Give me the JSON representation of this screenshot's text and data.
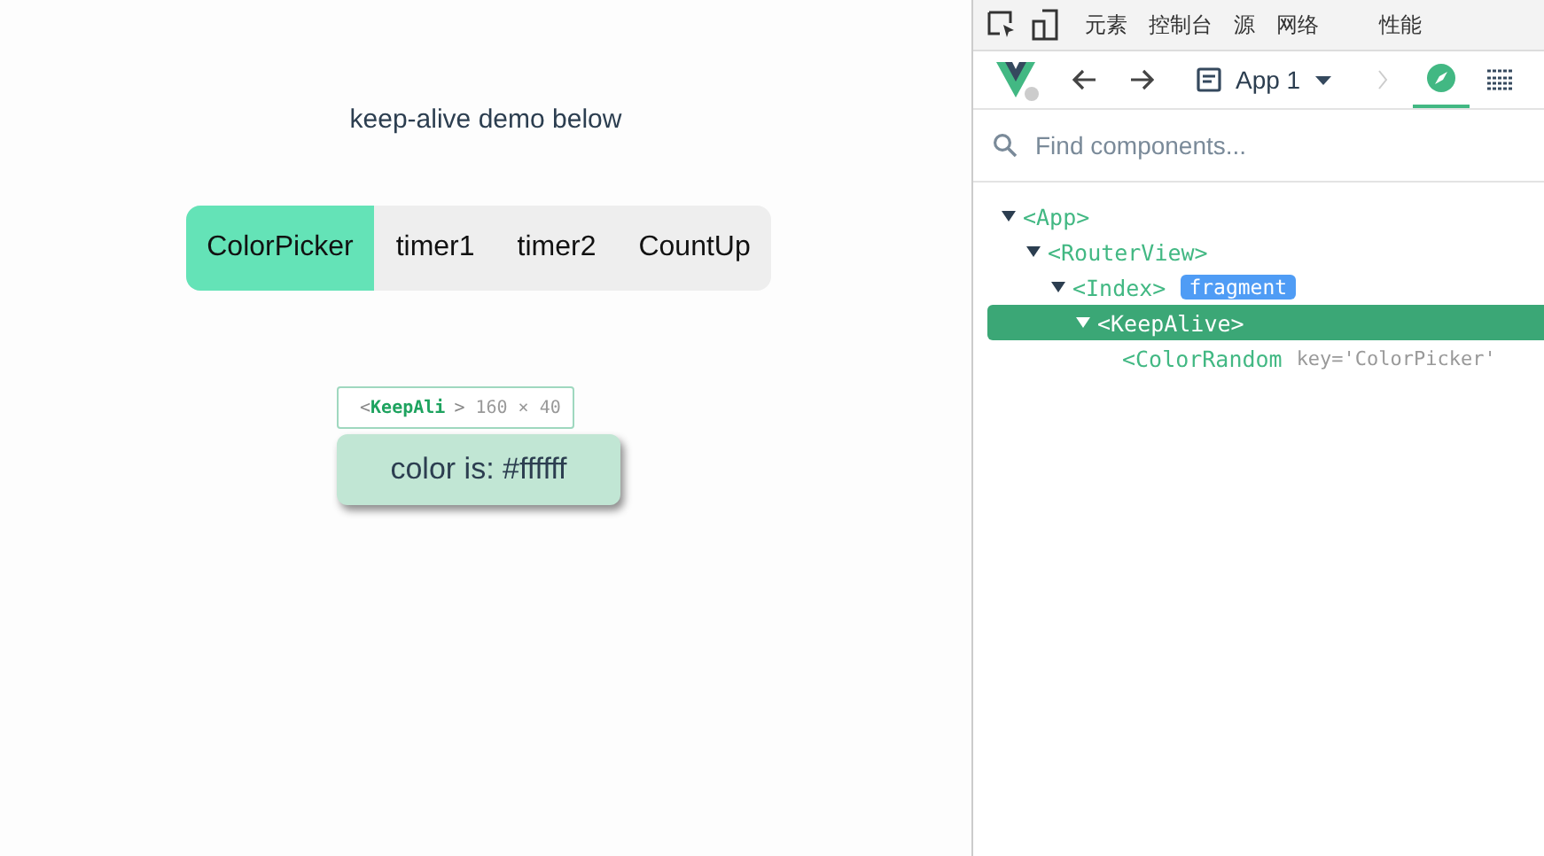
{
  "app": {
    "heading": "keep-alive demo below",
    "tabs": [
      {
        "label": "ColorPicker",
        "selected": true
      },
      {
        "label": "timer1",
        "selected": false
      },
      {
        "label": "timer2",
        "selected": false
      },
      {
        "label": "CountUp",
        "selected": false
      }
    ],
    "inspector_tooltip": {
      "open": "<",
      "name": "KeepAli",
      "close": ">",
      "size": "160 × 40"
    },
    "color_box": {
      "text": "color is: #ffffff"
    }
  },
  "devtools": {
    "panel_tabs": [
      {
        "label": "元素",
        "selected": false
      },
      {
        "label": "控制台",
        "selected": false
      },
      {
        "label": "源",
        "selected": false
      },
      {
        "label": "网络",
        "selected": false
      },
      {
        "label": "性能",
        "selected": false
      }
    ],
    "app_selector": "App 1",
    "search": {
      "placeholder": "Find components..."
    },
    "tree": [
      {
        "name": "<App>",
        "expanded": true,
        "selected": false,
        "children": [
          {
            "name": "<RouterView>",
            "expanded": true,
            "selected": false,
            "children": [
              {
                "name": "<Index>",
                "expanded": true,
                "selected": false,
                "badge": "fragment",
                "children": [
                  {
                    "name": "<KeepAlive>",
                    "expanded": true,
                    "selected": true,
                    "children": [
                      {
                        "name": "<ColorRandom",
                        "selected": false,
                        "attr": "key='ColorPicker'"
                      }
                    ]
                  }
                ]
              }
            ]
          }
        ]
      }
    ]
  }
}
